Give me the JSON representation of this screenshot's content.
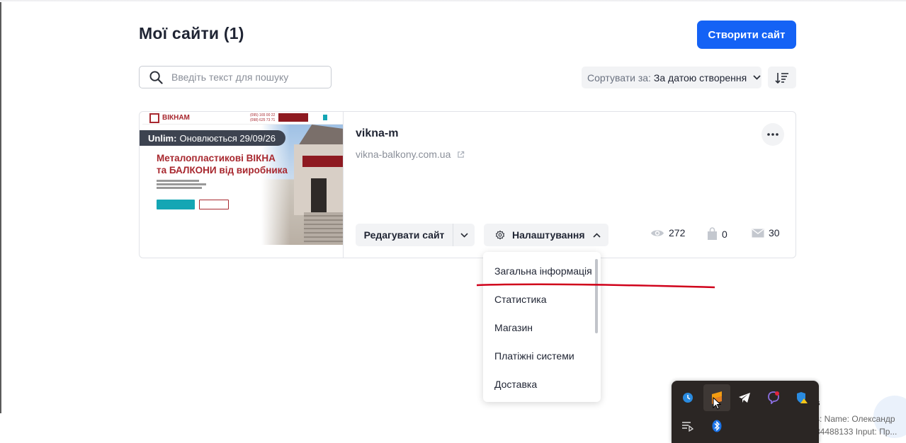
{
  "header": {
    "title": "Мої сайти (1)",
    "create_label": "Створити сайт"
  },
  "search": {
    "placeholder": "Введіть текст для пошуку"
  },
  "sort": {
    "label": "Сортувати за:",
    "value": "За датою створення"
  },
  "site": {
    "name": "vikna-m",
    "url": "vikna-balkony.com.ua",
    "plan_name": "Unlim:",
    "plan_status": "Оновлюється 29/09/26",
    "thumbnail": {
      "logo_text": "ВІКНАМ",
      "phones": [
        "(095) 165 00 22",
        "(098) 625 73 71"
      ],
      "headline_line1": "Металопластикові ВІКНА",
      "headline_line2": "та БАЛКОНИ від виробника"
    },
    "edit_label": "Редагувати сайт",
    "settings_label": "Налаштування",
    "stats": {
      "views": "272",
      "orders": "0",
      "messages": "30"
    }
  },
  "settings_menu": {
    "items": [
      {
        "label": "Загальна інформація"
      },
      {
        "label": "Статистика"
      },
      {
        "label": "Магазин"
      },
      {
        "label": "Платіжні системи"
      },
      {
        "label": "Доставка"
      }
    ]
  },
  "annotation": {
    "color": "#d0021b"
  },
  "taskbar_tray": {
    "icons": [
      "clock-sync-icon",
      "sublime-text-icon",
      "telegram-icon",
      "viber-icon",
      "windows-security-icon",
      "playlist-icon",
      "bluetooth-icon"
    ]
  },
  "notification": {
    "title": "s",
    "line1": "s: Name: Олександр",
    "line2": "34488133 Input: Пр..."
  },
  "colors": {
    "primary": "#1462f5",
    "text": "#1f2433",
    "muted": "#8a8f99",
    "brand_red": "#a8282f"
  }
}
